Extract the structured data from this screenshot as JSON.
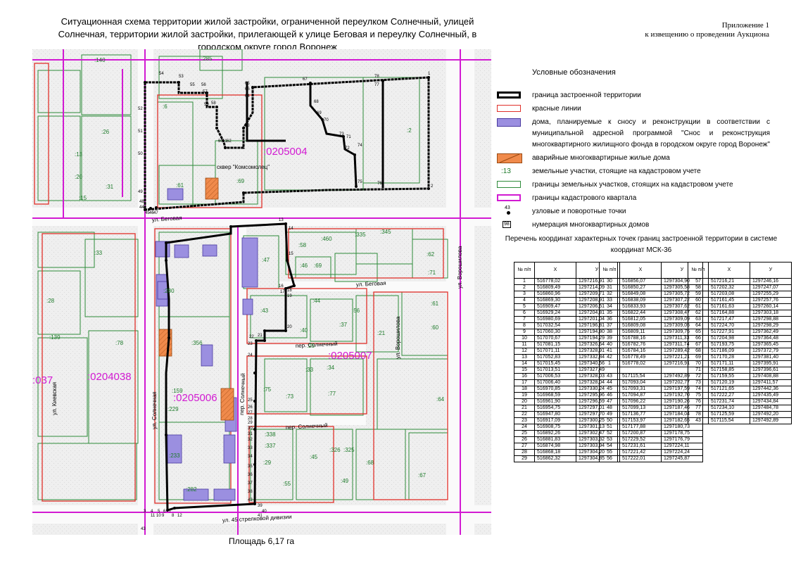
{
  "title": "Ситуационная схема территории жилой застройки, ограниченной переулком Солнечный, улицей Солнечная, территории жилой застройки, прилегающей к улице Беговая и переулку Солнечный, в городском округе город Воронеж",
  "appendix": {
    "line1": "Приложение 1",
    "line2": "к извещению о проведении Аукциона"
  },
  "area_label": "Площадь 6,17 га",
  "legend": {
    "title": "Условные обозначения",
    "items": [
      {
        "symbol": "bold-border",
        "text": "граница застроенной территории"
      },
      {
        "symbol": "red-border",
        "text": "красные линии"
      },
      {
        "symbol": "purple-fill",
        "text": "дома, планируемые к сносу и реконструкции в соответствии с муниципальной адресной программой \"Снос и реконструкция многоквартирного жилищного фонда в городском округе город Воронеж\""
      },
      {
        "symbol": "orange-hatch",
        "text": "аварийные многоквартирные жилые дома"
      },
      {
        "symbol": "cad-number",
        "label": ":13",
        "text": "земельные участки, стоящие на кадастровом учете"
      },
      {
        "symbol": "green-border",
        "text": "границы земельных участков, стоящих на кадастровом учете"
      },
      {
        "symbol": "magenta-border",
        "text": "границы кадастрового квартала"
      },
      {
        "symbol": "node-point",
        "label": "43",
        "text": "узловые и поворотные точки"
      },
      {
        "symbol": "house-number",
        "label": "98",
        "text": "нумерация многоквартирных домов"
      }
    ]
  },
  "coords": {
    "title": "Перечень координат характерных точек границ застроенной территории в системе координат МСК-36",
    "headers": {
      "num": "№ п/п",
      "x": "X",
      "y": "У"
    },
    "col1": [
      [
        "1",
        "516778,02",
        "1297216,91"
      ],
      [
        "2",
        "516809,49",
        "1297214,09"
      ],
      [
        "3",
        "516860,96",
        "1297209,71"
      ],
      [
        "4",
        "516869,30",
        "1297208,91"
      ],
      [
        "5",
        "516909,47",
        "1297206,51"
      ],
      [
        "6",
        "516929,24",
        "1297204,81"
      ],
      [
        "7",
        "516980,69",
        "1297201,04"
      ],
      [
        "8",
        "517032,54",
        "1297196,81"
      ],
      [
        "9",
        "517060,30",
        "1297194,80"
      ],
      [
        "10",
        "517070,67",
        "1297194,29"
      ],
      [
        "11",
        "517081,15",
        "1297326,64"
      ],
      [
        "12",
        "517071,11",
        "1297328,91"
      ],
      [
        "13",
        "517052,83",
        "1297332,84"
      ],
      [
        "14",
        "517015,45",
        "1297340,56"
      ],
      [
        "15",
        "517013,51",
        "1297327,49"
      ],
      [
        "16",
        "517006,53",
        "1297328,03"
      ],
      [
        "17",
        "517006,40",
        "1297328,04"
      ],
      [
        "18",
        "516970,85",
        "1297330,24"
      ],
      [
        "19",
        "516968,59",
        "1297295,96"
      ],
      [
        "20",
        "516961,90",
        "1297296,59"
      ],
      [
        "21",
        "516954,75",
        "1297297,01"
      ],
      [
        "22",
        "516947,80",
        "1297297,70"
      ],
      [
        "23",
        "516917,09",
        "1297300,25"
      ],
      [
        "24",
        "516908,75",
        "1297301,13"
      ],
      [
        "25",
        "516892,26",
        "1297302,47"
      ],
      [
        "26",
        "516881,83",
        "1297303,32"
      ],
      [
        "27",
        "516874,98",
        "1297303,94"
      ],
      [
        "28",
        "516868,18",
        "1297304,20"
      ],
      [
        "29",
        "516862,32",
        "1297304,85"
      ]
    ],
    "col2": [
      [
        "30",
        "516856,07",
        "1297304,90"
      ],
      [
        "31",
        "516850,27",
        "1297305,58"
      ],
      [
        "32",
        "516849,08",
        "1297305,72"
      ],
      [
        "33",
        "516838,09",
        "1297307,22"
      ],
      [
        "34",
        "516833,93",
        "1297307,62"
      ],
      [
        "35",
        "516822,44",
        "1297308,47"
      ],
      [
        "36",
        "516812,05",
        "1297309,09"
      ],
      [
        "37",
        "516809,08",
        "1297309,05"
      ],
      [
        "38",
        "516809,11",
        "1297309,75"
      ],
      [
        "39",
        "516788,16",
        "1297311,33"
      ],
      [
        "40",
        "516782,76",
        "1297311,74"
      ],
      [
        "41",
        "516784,16",
        "1297289,42"
      ],
      [
        "42",
        "516778,49",
        "1297221,21"
      ],
      [
        "1",
        "516778,02",
        "1297216,91"
      ],
      [
        "",
        "",
        " "
      ],
      [
        "43",
        "517115,54",
        "1297492,89"
      ],
      [
        "44",
        "517093,04",
        "1297202,77"
      ],
      [
        "45",
        "517093,31",
        "1297197,59"
      ],
      [
        "46",
        "517094,87",
        "1297192,70"
      ],
      [
        "47",
        "517096,22",
        "1297190,26"
      ],
      [
        "48",
        "517099,13",
        "1297187,46"
      ],
      [
        "49",
        "517136,77",
        "1297184,04"
      ],
      [
        "50",
        "517153,97",
        "1297182,65"
      ],
      [
        "51",
        "517177,88",
        "1297180,73"
      ],
      [
        "52",
        "517200,87",
        "1297178,75"
      ],
      [
        "53",
        "517229,52",
        "1297176,79"
      ],
      [
        "54",
        "517231,61",
        "1297224,11"
      ],
      [
        "55",
        "517221,42",
        "1297224,24"
      ],
      [
        "56",
        "517222,01",
        "1297245,87"
      ]
    ],
    "col3": [
      [
        "57",
        "517216,21",
        "1297246,16"
      ],
      [
        "58",
        "517202,32",
        "1297247,07"
      ],
      [
        "59",
        "517203,08",
        "1297255,29"
      ],
      [
        "60",
        "517161,45",
        "1297257,76"
      ],
      [
        "61",
        "517161,63",
        "1297260,14"
      ],
      [
        "62",
        "517164,88",
        "1297303,18"
      ],
      [
        "63",
        "517217,47",
        "1297298,88"
      ],
      [
        "64",
        "517224,70",
        "1297298,29"
      ],
      [
        "65",
        "517227,91",
        "1297362,49"
      ],
      [
        "66",
        "517204,98",
        "1297364,48"
      ],
      [
        "67",
        "517193,75",
        "1297365,45"
      ],
      [
        "68",
        "517186,09",
        "1297372,79"
      ],
      [
        "69",
        "517170,28",
        "1297381,40"
      ],
      [
        "70",
        "517171,11",
        "1297395,91"
      ],
      [
        "71",
        "517158,85",
        "1297396,61"
      ],
      [
        "72",
        "517159,55",
        "1297408,88"
      ],
      [
        "73",
        "517120,19",
        "1297411,57"
      ],
      [
        "74",
        "517121,65",
        "1297442,36"
      ],
      [
        "75",
        "517222,27",
        "1297435,49"
      ],
      [
        "76",
        "517231,74",
        "1297434,84"
      ],
      [
        "77",
        "517234,10",
        "1297484,78"
      ],
      [
        "78",
        "517125,59",
        "1297492,20"
      ],
      [
        "43",
        "517115,54",
        "1297492,89"
      ]
    ]
  },
  "map": {
    "quarter_labels": [
      ":0205004",
      ":0205007",
      ":0205006",
      ":0204038",
      ":037"
    ],
    "street_labels": [
      "ул. Беговая",
      "ул. Беговая",
      "пер. Солнечный",
      "пер. Солнечный",
      "ул. Солнечная",
      "пер. Солнечный",
      "ул. 45 стрелковой дивизии",
      "ул. Киевская",
      "ул. Ворошилова",
      "ул. Ворошилова"
    ],
    "place_label": "сквер \"Комсомолец\"",
    "parcel_labels": [
      ":140",
      ":285",
      ":6",
      ":26",
      ":13",
      ":20",
      ":31",
      ":15",
      ":61",
      ":69",
      ":2",
      ":58",
      ":460",
      ":335",
      ":345",
      ":62",
      ":46",
      ":69",
      ":71",
      ":47",
      ":33",
      ":28",
      ":280",
      ":43",
      ":44",
      ":56",
      ":40",
      ":37",
      ":21",
      ":61",
      ":60",
      ":356",
      ":25",
      ":33",
      ":34",
      ":75",
      ":73",
      ":77",
      ":64",
      ":229",
      ":338",
      ":337",
      ":326",
      ":325",
      ":233",
      ":45",
      ":68",
      ":29",
      ":49",
      ":139",
      ":78",
      ":159",
      ":282",
      ":55",
      ":67"
    ],
    "point_labels": [
      "43",
      "44",
      "45",
      "46",
      "47",
      "48",
      "49",
      "50",
      "51",
      "52",
      "53",
      "54",
      "55",
      "56",
      "57",
      "58",
      "59",
      "60",
      "61",
      "62",
      "63",
      "64",
      "65",
      "66",
      "67",
      "68",
      "69",
      "70",
      "71",
      "72",
      "73",
      "74",
      "75",
      "76",
      "77",
      "78",
      "1",
      "2",
      "3",
      "4",
      "5",
      "6",
      "7",
      "8",
      "9",
      "10",
      "11",
      "12",
      "13",
      "14",
      "15",
      "16",
      "17",
      "18",
      "19",
      "20",
      "21",
      "22",
      "23",
      "24",
      "25",
      "26",
      "27",
      "28",
      "29",
      "30",
      "31",
      "32",
      "33",
      "34",
      "35",
      "36",
      "37",
      "38",
      "39",
      "40",
      "41",
      "42"
    ]
  },
  "colors": {
    "boundary": "#000000",
    "red_line": "#e0302a",
    "parcel": "#2e8b3a",
    "quarter": "#d21ad2",
    "demolish": "#9b8fe0",
    "emergency": "#f08a4b"
  }
}
